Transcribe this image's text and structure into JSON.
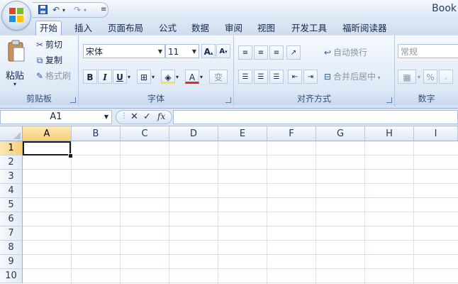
{
  "app": {
    "title": "Book"
  },
  "quick_access": {
    "save_icon": "save-icon",
    "undo_icon": "undo-icon",
    "redo_icon": "redo-icon"
  },
  "tabs": [
    {
      "label": "开始",
      "active": true
    },
    {
      "label": "插入"
    },
    {
      "label": "页面布局"
    },
    {
      "label": "公式"
    },
    {
      "label": "数据"
    },
    {
      "label": "审阅"
    },
    {
      "label": "视图"
    },
    {
      "label": "开发工具"
    },
    {
      "label": "福昕阅读器"
    }
  ],
  "ribbon": {
    "clipboard": {
      "label": "剪贴板",
      "paste": "粘贴",
      "cut": "剪切",
      "copy": "复制",
      "format_painter": "格式刷"
    },
    "font": {
      "label": "字体",
      "font_name": "宋体",
      "font_size": "11",
      "bold": "B",
      "italic": "I",
      "underline": "U",
      "font_color": "A",
      "phonetic": "变"
    },
    "alignment": {
      "label": "对齐方式",
      "wrap_text": "自动换行",
      "merge_center": "合并后居中"
    },
    "number": {
      "label": "数字",
      "format": "常规",
      "percent": "%"
    }
  },
  "formula_bar": {
    "name_box": "A1",
    "cancel": "✕",
    "enter": "✓",
    "fx": "fx",
    "value": ""
  },
  "sheet": {
    "columns": [
      "A",
      "B",
      "C",
      "D",
      "E",
      "F",
      "G",
      "H",
      "I"
    ],
    "rows": [
      "1",
      "2",
      "3",
      "4",
      "5",
      "6",
      "7",
      "8",
      "9",
      "10"
    ],
    "active_cell": "A1"
  },
  "colors": {
    "accent": "#f8cf7a",
    "ribbon_bg": "#e3ecf8",
    "font_color_bar": "#e0282a"
  }
}
